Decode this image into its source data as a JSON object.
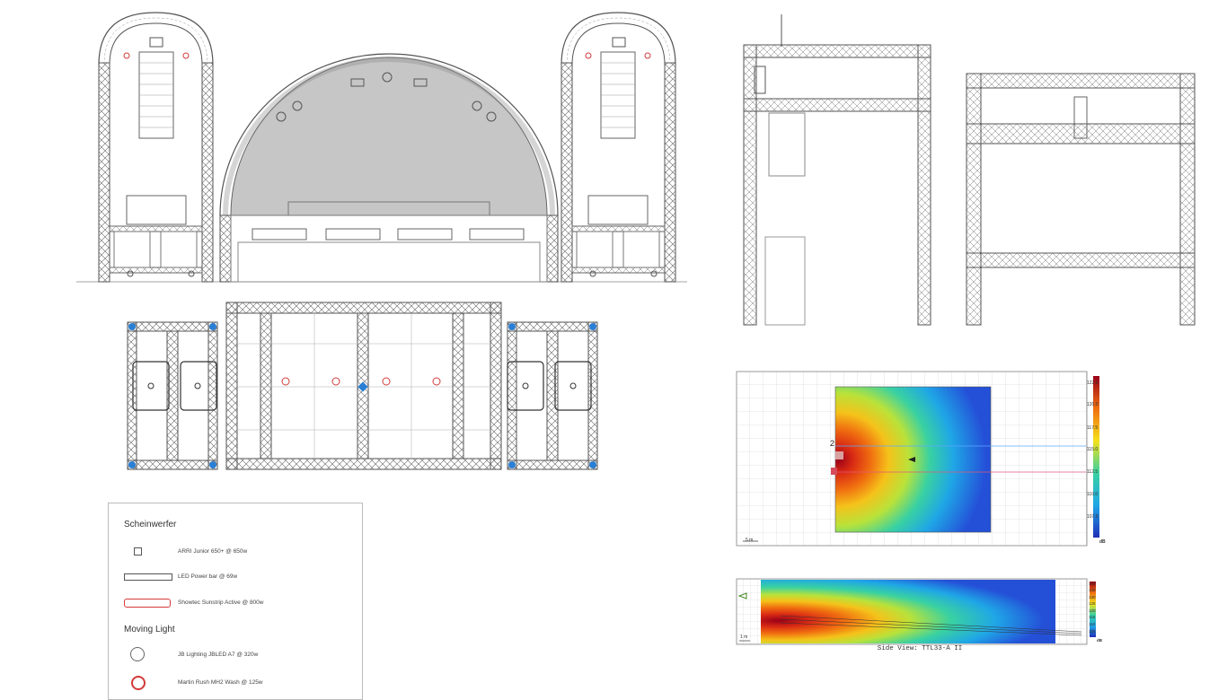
{
  "legend": {
    "cat_spots": "Scheinwerfer",
    "spots": [
      {
        "label": "ARRI Junior 650+ @ 650w",
        "icon": "square-spot-icon"
      },
      {
        "label": "LED Power bar @ 69w",
        "icon": "led-bar-icon"
      },
      {
        "label": "Showtec Sunstrip Active @ 800w",
        "icon": "sunstrip-icon"
      }
    ],
    "cat_moving": "Moving Light",
    "moving": [
      {
        "label": "JB Lighting JBLED A7 @ 320w",
        "icon": "moving-head-icon"
      },
      {
        "label": "Martin Rush MH2 Wash @ 125w",
        "icon": "wash-light-icon"
      }
    ]
  },
  "top_map": {
    "scale": "5 m",
    "colorbar_ticks": [
      "122.5",
      "120.0",
      "117.5",
      "115.0",
      "112.5",
      "110.0",
      "107.5"
    ],
    "unit": "dB",
    "marker": "2"
  },
  "side_map": {
    "scale": "1 m",
    "colorbar_ticks": [
      "140",
      "135",
      "130",
      "125",
      "120",
      "115",
      "110",
      "105"
    ],
    "unit": "dB",
    "caption": "Side View: TTL33-A II"
  },
  "colors": {
    "truss": "#555555",
    "roof": "#c4c4c4",
    "heat_low": "#1f4fd8",
    "heat_high": "#b3001b",
    "fixture_red": "#d33a3a",
    "fixture_blue": "#2a7fd4"
  }
}
